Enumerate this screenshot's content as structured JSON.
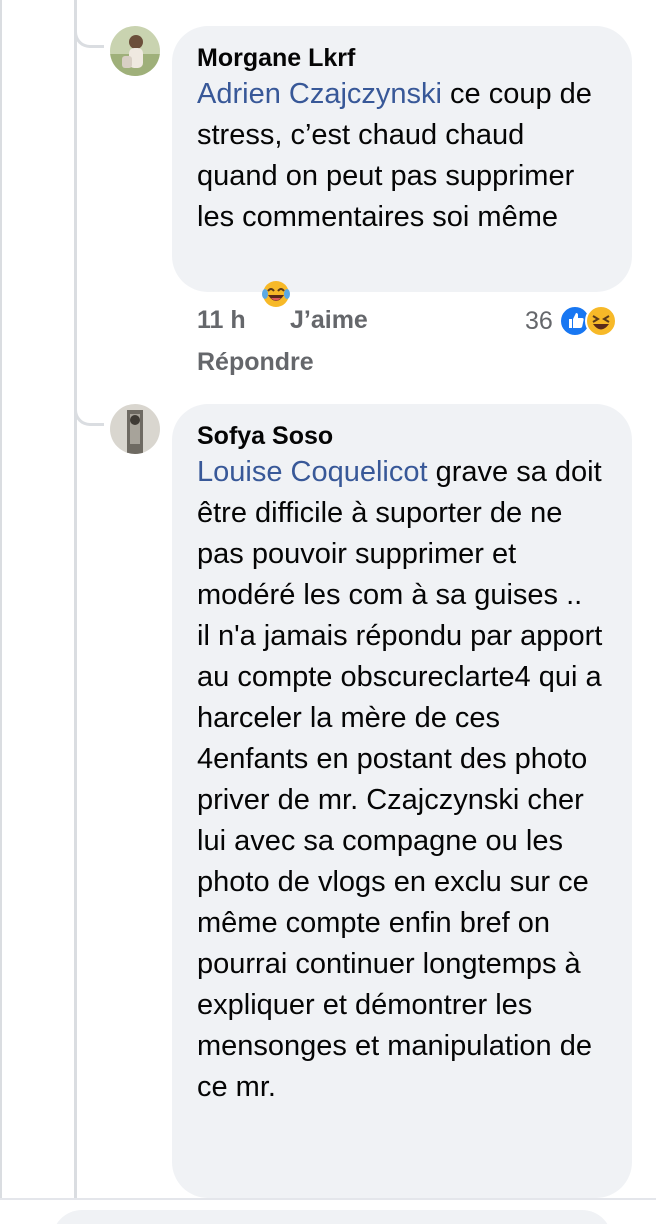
{
  "comments": [
    {
      "author": "Morgane Lkrf",
      "mention": "Adrien Czajczynski",
      "text": " ce coup de stress, c’est chaud chaud quand on peut pas supprimer les commentaires soi même",
      "emoji": "laughing-tears-emoji",
      "time": "11 h",
      "like_label": "J’aime",
      "reaction_count": "36",
      "reaction_icons": [
        "like-reaction-icon",
        "haha-reaction-icon"
      ],
      "reply_label": "Répondre"
    },
    {
      "author": "Sofya Soso",
      "mention": "Louise Coquelicot",
      "text": " grave sa doit être difficile à suporter de ne pas pouvoir supprimer et modéré les com à sa guises ..   il n'a jamais répondu par apport au compte obscureclarte4 qui a harceler la mère de ces 4enfants en postant des photo priver de mr. Czajczynski cher lui avec sa compagne ou les photo de vlogs en exclu sur ce même compte enfin bref on pourrai continuer longtemps à expliquer et démontrer les mensonges et manipulation de ce mr."
    }
  ],
  "colors": {
    "bubble_bg": "#f0f2f5",
    "mention": "#385898",
    "meta_text": "#65676b",
    "like_blue": "#1877f2",
    "haha_yellow": "#f7b928"
  }
}
